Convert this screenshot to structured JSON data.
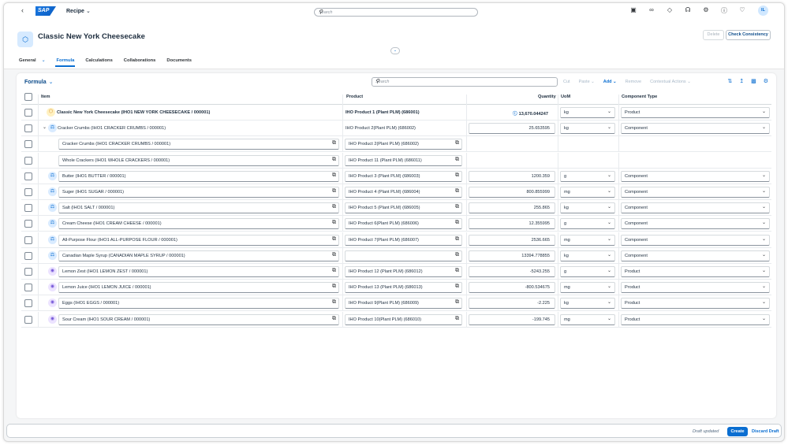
{
  "shell": {
    "logo": "SAP",
    "app_title": "Recipe",
    "search_placeholder": "Search",
    "avatar": "IL"
  },
  "header": {
    "title": "Classic New York Cheesecake",
    "delete_label": "Delete",
    "check_label": "Check Consistency"
  },
  "tabs": [
    {
      "label": "General"
    },
    {
      "label": "Formula"
    },
    {
      "label": "Calculations"
    },
    {
      "label": "Collaborations"
    },
    {
      "label": "Documents"
    }
  ],
  "toolbar": {
    "title": "Formula",
    "search_placeholder": "Search",
    "cut": "Cut",
    "paste": "Paste",
    "add": "Add",
    "remove": "Remove",
    "contextual": "Contextual Actions"
  },
  "columns": {
    "item": "Item",
    "product": "Product",
    "quantity": "Quantity",
    "uom": "UoM",
    "component_type": "Component Type"
  },
  "rows": [
    {
      "item": "Classic New York Cheesecake (IHO1 NEW YORK CHEESECAKE / 000001)",
      "product": "IHO Product 1 (Plant PLM) (686001)",
      "quantity": "13,670.044247",
      "uom": "kg",
      "type": "Product"
    },
    {
      "item": "Cracker Crumbs (IHO1 CRACKER CRUMBS / 000001)",
      "product": "IHO Product 2(Plant PLM) (686002)",
      "quantity": "25.653595",
      "uom": "kg",
      "type": "Component"
    },
    {
      "item": "Cracker Crumbs (IHO1 CRACKER CRUMBS / 000001)",
      "product": "IHO Product 2(Plant PLM) (686002)",
      "quantity": "",
      "uom": "",
      "type": ""
    },
    {
      "item": "Whole Crackers (IHO1 WHOLE CRACKERS / 000001)",
      "product": "IHO Product 11 (Plant PLM) (686011)",
      "quantity": "",
      "uom": "",
      "type": ""
    },
    {
      "item": "Butter (IHO1 BUTTER / 000001)",
      "product": "IHO Product 3 (Plant PLM) (686003)",
      "quantity": "1200.359",
      "uom": "g",
      "type": "Component"
    },
    {
      "item": "Suger (IHO1 SUGAR / 000001)",
      "product": "IHO Product 4 (Plant PLM) (686004)",
      "quantity": "800.855999",
      "uom": "mg",
      "type": "Component"
    },
    {
      "item": "Salt (IHO1 SALT / 000001)",
      "product": "IHO Product 5 (Plant PLM) (686005)",
      "quantity": "255.865",
      "uom": "kg",
      "type": "Component"
    },
    {
      "item": "Cream Cheese (IHO1 CREAM CHEESE / 000001)",
      "product": "IHO Product 6(Plant PLM) (686006)",
      "quantity": "12.355995",
      "uom": "g",
      "type": "Component"
    },
    {
      "item": "All-Purpose Flour (IHO1 ALL-PURPOSE FLOUR / 000001)",
      "product": "IHO Product 7(Plant PLM) (686007)",
      "quantity": "2536.665",
      "uom": "mg",
      "type": "Component"
    },
    {
      "item": "Canadian Maple Syrup (CANADIAN MAPLE SYRUP / 000001)",
      "product": "",
      "quantity": "13394.778855",
      "uom": "kg",
      "type": "Component"
    },
    {
      "item": "Lemon Zest (IHO1 LEMON ZEST / 000001)",
      "product": "IHO Product 12 (Plant PLM) (686012)",
      "quantity": "-5243.255",
      "uom": "g",
      "type": "Product"
    },
    {
      "item": "Lemon Juice (IHO1 LEMON JUICE / 000001)",
      "product": "IHO Product 13 (Plant PLM) (686013)",
      "quantity": "-800.534675",
      "uom": "mg",
      "type": "Product"
    },
    {
      "item": "Eggs (IHO1 EGGS / 000001)",
      "product": "IHO Product 9(Plant PLM) (686009)",
      "quantity": "-2.225",
      "uom": "kg",
      "type": "Product"
    },
    {
      "item": "Sour Cream (IHO1 SOUR CREAM / 000001)",
      "product": "IHO Product 10(Plant PLM) (686010)",
      "quantity": "-199.745",
      "uom": "mg",
      "type": "Product"
    }
  ],
  "footer": {
    "draft": "Draft updated",
    "create": "Create",
    "discard": "Discard Draft"
  }
}
